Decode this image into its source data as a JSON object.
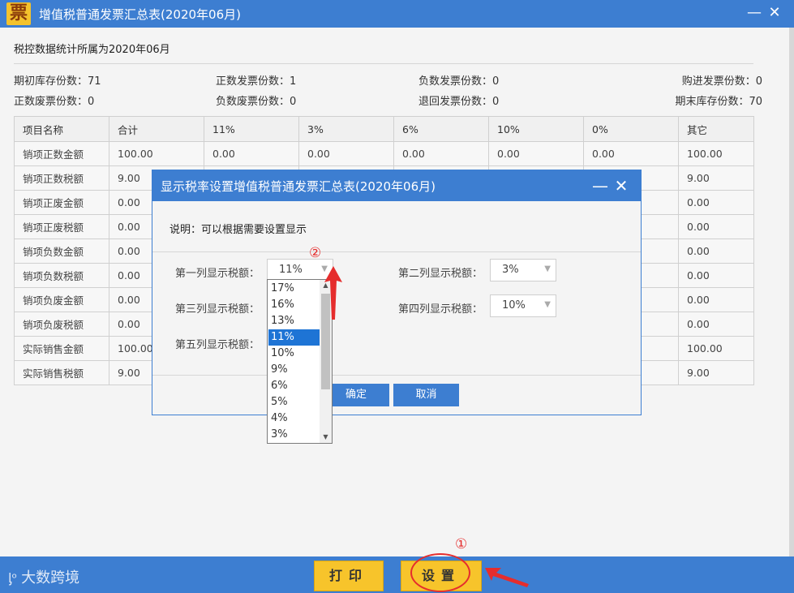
{
  "window": {
    "logo": "票",
    "title": "增值税普通发票汇总表(2020年06月)",
    "minimize": "—",
    "close": "✕"
  },
  "subtitle": "税控数据统计所属为2020年06月",
  "stats": {
    "s1": "期初库存份数：71",
    "s2": "正数发票份数：1",
    "s3": "负数发票份数：0",
    "s4": "购进发票份数：0",
    "s5": "正数废票份数：0",
    "s6": "负数废票份数：0",
    "s7": "退回发票份数：0",
    "s8": "期末库存份数：70"
  },
  "table": {
    "headers": [
      "项目名称",
      "合计",
      "11%",
      "3%",
      "6%",
      "10%",
      "0%",
      "其它"
    ],
    "rows": [
      [
        "销项正数金额",
        "100.00",
        "0.00",
        "0.00",
        "0.00",
        "0.00",
        "0.00",
        "100.00"
      ],
      [
        "销项正数税额",
        "9.00",
        "",
        "",
        "",
        "",
        "",
        "9.00"
      ],
      [
        "销项正废金额",
        "0.00",
        "",
        "",
        "",
        "",
        "",
        "0.00"
      ],
      [
        "销项正废税额",
        "0.00",
        "",
        "",
        "",
        "",
        "",
        "0.00"
      ],
      [
        "销项负数金额",
        "0.00",
        "",
        "",
        "",
        "",
        "",
        "0.00"
      ],
      [
        "销项负数税额",
        "0.00",
        "",
        "",
        "",
        "",
        "",
        "0.00"
      ],
      [
        "销项负废金额",
        "0.00",
        "",
        "",
        "",
        "",
        "",
        "0.00"
      ],
      [
        "销项负废税额",
        "0.00",
        "",
        "",
        "",
        "",
        "",
        "0.00"
      ],
      [
        "实际销售金额",
        "100.00",
        "",
        "",
        "",
        "",
        "",
        "100.00"
      ],
      [
        "实际销售税额",
        "9.00",
        "",
        "",
        "",
        "",
        "",
        "9.00"
      ]
    ]
  },
  "bottom": {
    "brand": "大数跨境",
    "print_label": "打印",
    "settings_label": "设置",
    "marker1": "①",
    "marker2": "②"
  },
  "dialog": {
    "title": "显示税率设置增值税普通发票汇总表(2020年06月)",
    "minimize": "—",
    "close": "✕",
    "note": "说明：可以根据需要设置显示",
    "col1_label": "第一列显示税额：",
    "col1_value": "11%",
    "col2_label": "第二列显示税额：",
    "col2_value": "3%",
    "col3_label": "第三列显示税额：",
    "col4_label": "第四列显示税额：",
    "col4_value": "10%",
    "col5_label": "第五列显示税额：",
    "ok_label": "确定",
    "cancel_label": "取消",
    "dropdown_options": [
      "17%",
      "16%",
      "13%",
      "11%",
      "10%",
      "9%",
      "6%",
      "5%",
      "4%",
      "3%"
    ],
    "dropdown_selected": "11%"
  },
  "colors": {
    "accent": "#3d7ed1",
    "button_yellow": "#f7c42b",
    "marker_red": "#e52d2d",
    "selection": "#1e74d5"
  }
}
